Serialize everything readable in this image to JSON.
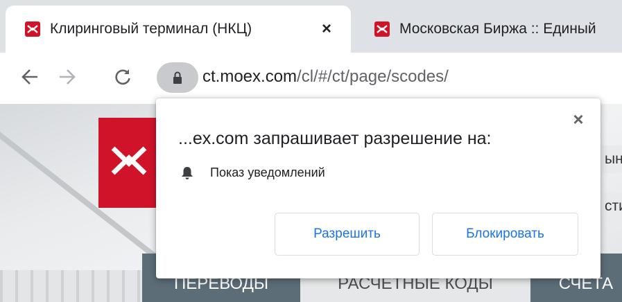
{
  "browser": {
    "tabs": [
      {
        "title": "Клиринговый терминал (НКЦ)",
        "close": "×"
      },
      {
        "title": "Московская Биржа :: Единый"
      }
    ],
    "url": {
      "host": "ct.moex.com",
      "path": "/cl/#/ct/page/scodes/"
    }
  },
  "page": {
    "partial_button_1": "ын",
    "partial_button_2": "сти",
    "nav": [
      "ПЕРЕВОДЫ",
      "РАСЧЕТНЫЕ КОДЫ",
      "СЧЕТА"
    ]
  },
  "popup": {
    "title": "...ex.com запрашивает разрешение на:",
    "close": "×",
    "permission": "Показ уведомлений",
    "allow_label": "Разрешить",
    "block_label": "Блокировать"
  },
  "colors": {
    "brand_red": "#d1132a",
    "nav_bg": "#5c6d77",
    "button_text": "#1a73e8"
  }
}
